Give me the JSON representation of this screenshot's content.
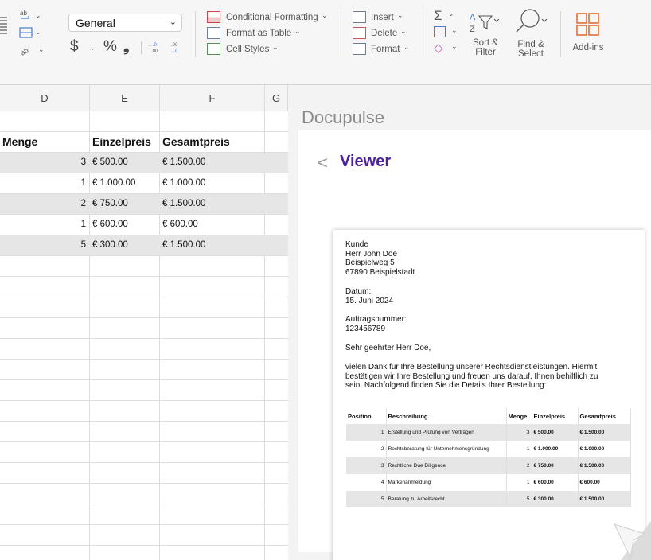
{
  "ribbon": {
    "number_format": "General",
    "currency_symbol": "$",
    "percent_symbol": "%",
    "comma_symbol": "❟",
    "decrease_decimal": "←.0 .00",
    "increase_decimal": ".00 →.0",
    "conditional_formatting": "Conditional Formatting",
    "format_as_table": "Format as Table",
    "cell_styles": "Cell Styles",
    "insert": "Insert",
    "delete": "Delete",
    "format": "Format",
    "sort_filter_line1": "Sort &",
    "sort_filter_line2": "Filter",
    "find_select_line1": "Find &",
    "find_select_line2": "Select",
    "addins": "Add-ins"
  },
  "sheet": {
    "columns": [
      "D",
      "E",
      "F",
      "G"
    ],
    "headers": {
      "menge": "Menge",
      "einzelpreis": "Einzelpreis",
      "gesamtpreis": "Gesamtpreis"
    },
    "rows": [
      {
        "menge": "3",
        "einzel": "€ 500.00",
        "gesamt": "€ 1.500.00"
      },
      {
        "menge": "1",
        "einzel": "€ 1.000.00",
        "gesamt": "€ 1.000.00"
      },
      {
        "menge": "2",
        "einzel": "€ 750.00",
        "gesamt": "€ 1.500.00"
      },
      {
        "menge": "1",
        "einzel": "€ 600.00",
        "gesamt": "€ 600.00"
      },
      {
        "menge": "5",
        "einzel": "€ 300.00",
        "gesamt": "€ 1.500.00"
      }
    ]
  },
  "pane": {
    "app_title": "Docupulse",
    "viewer_title": "Viewer",
    "back_glyph": "<"
  },
  "document": {
    "kunde_label": "Kunde",
    "kunde_name": "Herr John Doe",
    "kunde_street": "Beispielweg 5",
    "kunde_city": "67890 Beispielstadt",
    "datum_label": "Datum:",
    "datum_value": "15. Juni 2024",
    "auftrag_label": "Auftragsnummer:",
    "auftrag_value": "123456789",
    "greeting": "Sehr geehrter Herr Doe,",
    "body_line1": "vielen Dank für Ihre Bestellung unserer Rechtsdienstleistungen. Hiermit",
    "body_line2": "bestätigen wir Ihre Bestellung und freuen uns darauf, Ihnen behilflich zu",
    "body_line3": "sein. Nachfolgend finden Sie die Details Ihrer Bestellung:",
    "table_headers": {
      "position": "Position",
      "beschreibung": "Beschreibung",
      "menge": "Menge",
      "einzelpreis": "Einzelpreis",
      "gesamtpreis": "Gesamtpreis"
    },
    "table_rows": [
      {
        "pos": "1",
        "desc": "Erstellung und Prüfung von Verträgen",
        "menge": "3",
        "einzel": "€ 500.00",
        "gesamt": "€ 1.500.00"
      },
      {
        "pos": "2",
        "desc": "Rechtsberatung für Unternehmensgründung",
        "menge": "1",
        "einzel": "€ 1.000.00",
        "gesamt": "€ 1.000.00"
      },
      {
        "pos": "3",
        "desc": "Rechtliche Due Diligence",
        "menge": "2",
        "einzel": "€ 750.00",
        "gesamt": "€ 1.500.00"
      },
      {
        "pos": "4",
        "desc": "Markenanmeldung",
        "menge": "1",
        "einzel": "€ 600.00",
        "gesamt": "€ 600.00"
      },
      {
        "pos": "5",
        "desc": "Beratung zu Arbeitsrecht",
        "menge": "5",
        "einzel": "€ 300.00",
        "gesamt": "€ 1.500.00"
      }
    ]
  },
  "colors": {
    "accent": "#4b1fa6",
    "alt_row": "#e6e6e6",
    "addins_icon": "#e0703a"
  }
}
